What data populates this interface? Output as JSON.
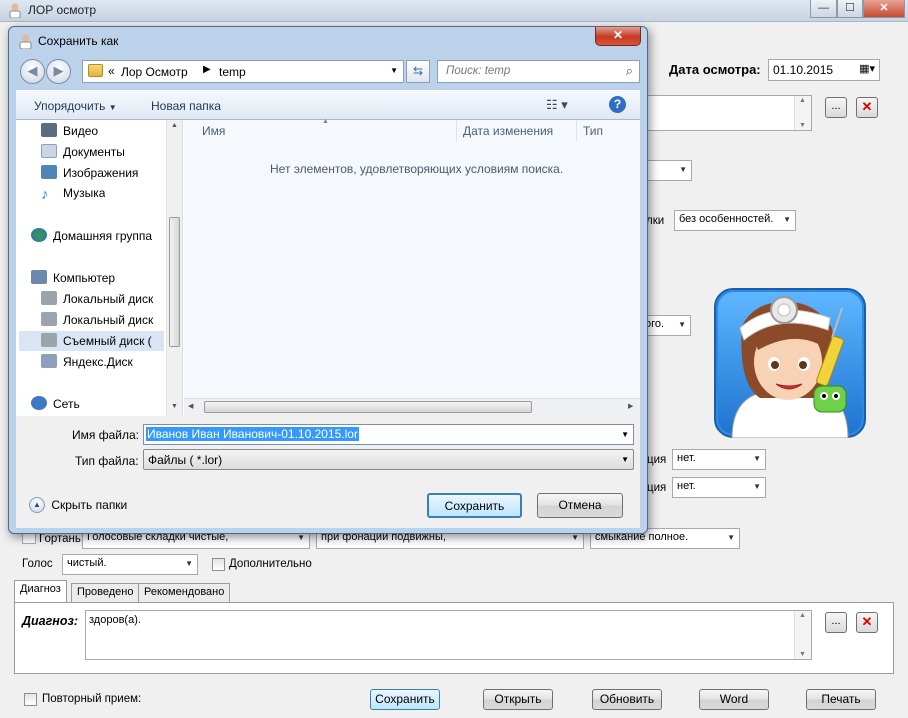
{
  "main_window": {
    "title": "ЛОР осмотр",
    "controls": [
      "—",
      "☐",
      "✕"
    ],
    "date_label": "Дата осмотра:",
    "date_value": "01.10.2015",
    "browse_button": "...",
    "delete_button": "✕",
    "dropdown_features": "без особенностей.",
    "dropdown_features_prefix": "лки",
    "dropdown_go": "ого.",
    "dropdown_net1": "нет.",
    "dropdown_net2": "нет.",
    "dropdown_net1_prefix": "ция",
    "dropdown_net2_prefix": "ция",
    "larynx_row": {
      "label": "Гортань:",
      "value1": "Голосовые складки чистые,",
      "value2": "при фонации подвижны,",
      "value3": "смыкание полное."
    },
    "voice_label": "Голос",
    "voice_value": "чистый.",
    "additional_label": "Дополнительно",
    "tabs": [
      "Диагноз",
      "Проведено",
      "Рекомендовано"
    ],
    "diagnosis_label": "Диагноз:",
    "diagnosis_value": "здоров(а).",
    "repeat_label": "Повторный прием:",
    "buttons": {
      "save": "Сохранить",
      "open": "Открыть",
      "update": "Обновить",
      "word": "Word",
      "print": "Печать"
    }
  },
  "dialog": {
    "title": "Сохранить как",
    "close": "✕",
    "breadcrumb": [
      "Лор Осмотр",
      "temp"
    ],
    "breadcrumb_prefix": "«",
    "search_placeholder": "Поиск: temp",
    "toolbar": {
      "organize": "Упорядочить",
      "new_folder": "Новая папка",
      "help": "?"
    },
    "nav_items": [
      {
        "label": "Видео",
        "icon": "video-icon",
        "color": "#5a6b82"
      },
      {
        "label": "Документы",
        "icon": "documents-icon",
        "color": "#c9d6e6"
      },
      {
        "label": "Изображения",
        "icon": "images-icon",
        "color": "#4f86b8"
      },
      {
        "label": "Музыка",
        "icon": "music-icon",
        "color": "#3d7cc9"
      },
      {
        "label": "Домашняя группа",
        "icon": "homegroup-icon",
        "color": "#3a9c4a"
      },
      {
        "label": "Компьютер",
        "icon": "computer-icon",
        "color": "#6b89ad"
      },
      {
        "label": "Локальный диск",
        "icon": "drive-icon",
        "color": "#9aa4ad"
      },
      {
        "label": "Локальный диск",
        "icon": "drive-icon",
        "color": "#9aa4ad"
      },
      {
        "label": "Съемный диск (",
        "icon": "removable-drive-icon",
        "color": "#9aa4ad"
      },
      {
        "label": "Яндекс.Диск",
        "icon": "yandex-disk-icon",
        "color": "#8aa0bd"
      },
      {
        "label": "Сеть",
        "icon": "network-icon",
        "color": "#3c78c4"
      }
    ],
    "columns": {
      "name": "Имя",
      "date": "Дата изменения",
      "type": "Тип"
    },
    "empty_message": "Нет элементов, удовлетворяющих условиям поиска.",
    "filename_label": "Имя файла:",
    "filename_value": "Иванов Иван Иванович-01.10.2015.lor",
    "filetype_label": "Тип файла:",
    "filetype_value": "Файлы ( *.lor)",
    "hide_folders": "Скрыть папки",
    "save_button": "Сохранить",
    "cancel_button": "Отмена"
  },
  "colors": {
    "dialog_frame": "#bcd1ea",
    "selection": "#3399ff",
    "close_red": "#c43a22"
  }
}
